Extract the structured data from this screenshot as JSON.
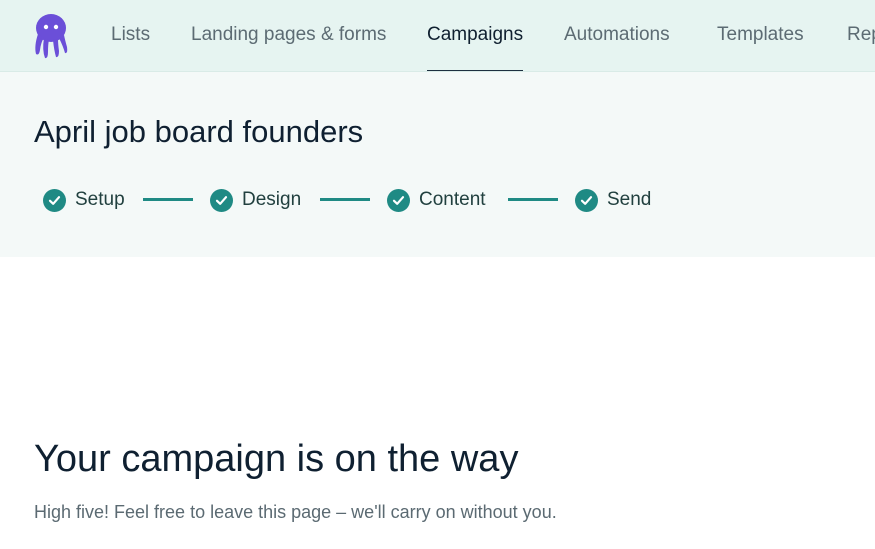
{
  "nav": {
    "items": [
      {
        "label": "Lists"
      },
      {
        "label": "Landing pages & forms"
      },
      {
        "label": "Campaigns",
        "active": true
      },
      {
        "label": "Automations"
      },
      {
        "label": "Templates"
      },
      {
        "label": "Rep"
      }
    ]
  },
  "campaign": {
    "title": "April job board founders",
    "steps": [
      {
        "label": "Setup",
        "status": "complete"
      },
      {
        "label": "Design",
        "status": "complete"
      },
      {
        "label": "Content",
        "status": "complete"
      },
      {
        "label": "Send",
        "status": "complete"
      }
    ]
  },
  "success": {
    "title": "Your campaign is on the way",
    "subtitle": "High five! Feel free to leave this page – we'll carry on without you."
  },
  "colors": {
    "accent": "#1f8a84",
    "logo": "#6b4fd8",
    "nav_background": "#e6f4f1",
    "header_background": "#f4f9f8"
  },
  "icons": [
    "octopus-logo-icon",
    "check-circle-icon"
  ]
}
